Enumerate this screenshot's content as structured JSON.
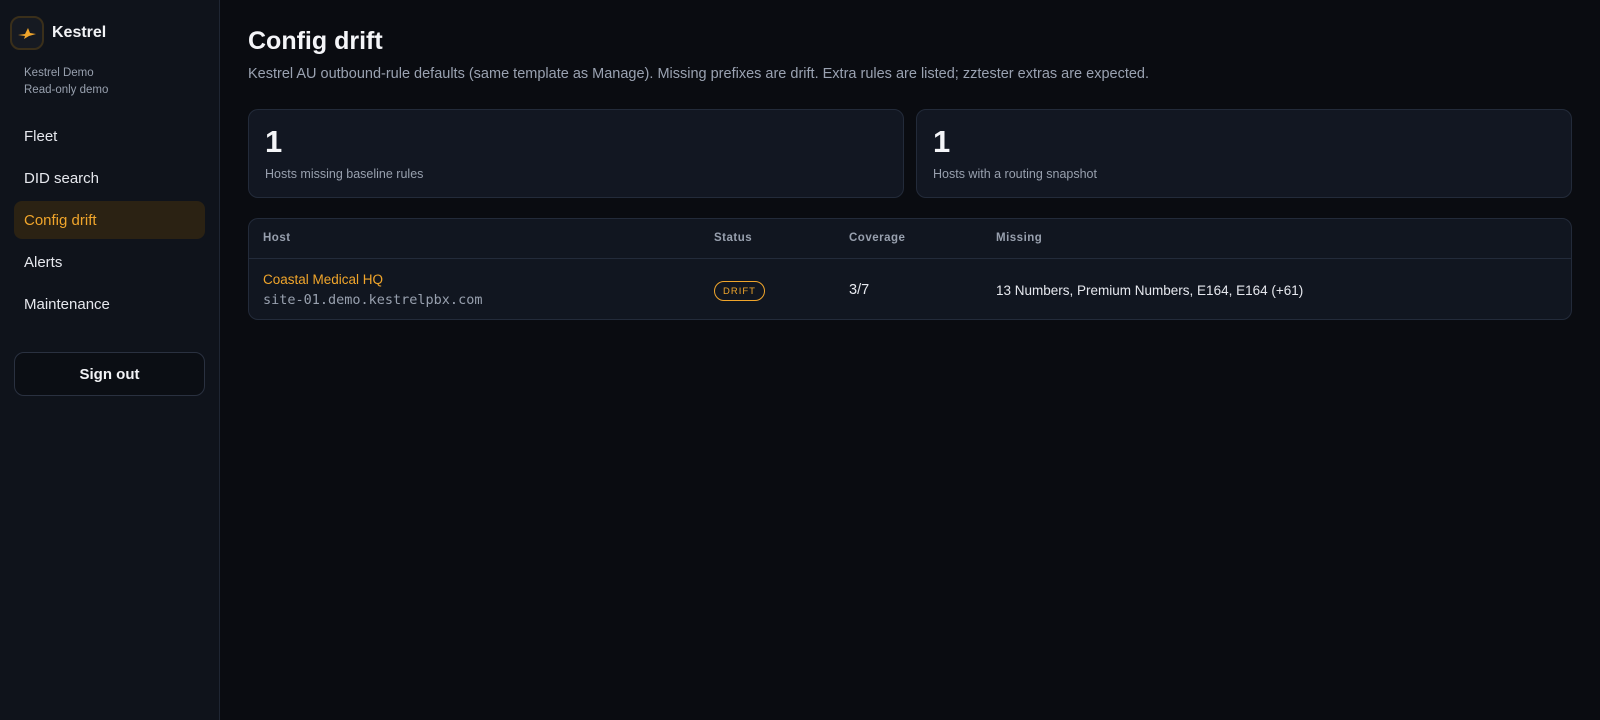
{
  "app": {
    "name": "Kestrel",
    "org_name": "Kestrel Demo",
    "org_mode": "Read-only demo",
    "logo_icon": "kestrel-bird-logo",
    "accent_color": "#f0a52b"
  },
  "sidebar": {
    "items": [
      {
        "label": "Fleet",
        "active": false
      },
      {
        "label": "DID search",
        "active": false
      },
      {
        "label": "Config drift",
        "active": true
      },
      {
        "label": "Alerts",
        "active": false
      },
      {
        "label": "Maintenance",
        "active": false
      }
    ],
    "signout_label": "Sign out"
  },
  "page": {
    "title": "Config drift",
    "subtitle": "Kestrel AU outbound-rule defaults (same template as Manage). Missing prefixes are drift. Extra rules are listed; zztester extras are expected."
  },
  "stats": [
    {
      "value": "1",
      "label": "Hosts missing baseline rules"
    },
    {
      "value": "1",
      "label": "Hosts with a routing snapshot"
    }
  ],
  "table": {
    "headers": {
      "host": "Host",
      "status": "Status",
      "coverage": "Coverage",
      "missing": "Missing"
    },
    "rows": [
      {
        "host_name": "Coastal Medical HQ",
        "host_address": "site-01.demo.kestrelpbx.com",
        "status": "DRIFT",
        "coverage": "3/7",
        "missing": "13 Numbers, Premium Numbers, E164, E164 (+61)"
      }
    ]
  }
}
